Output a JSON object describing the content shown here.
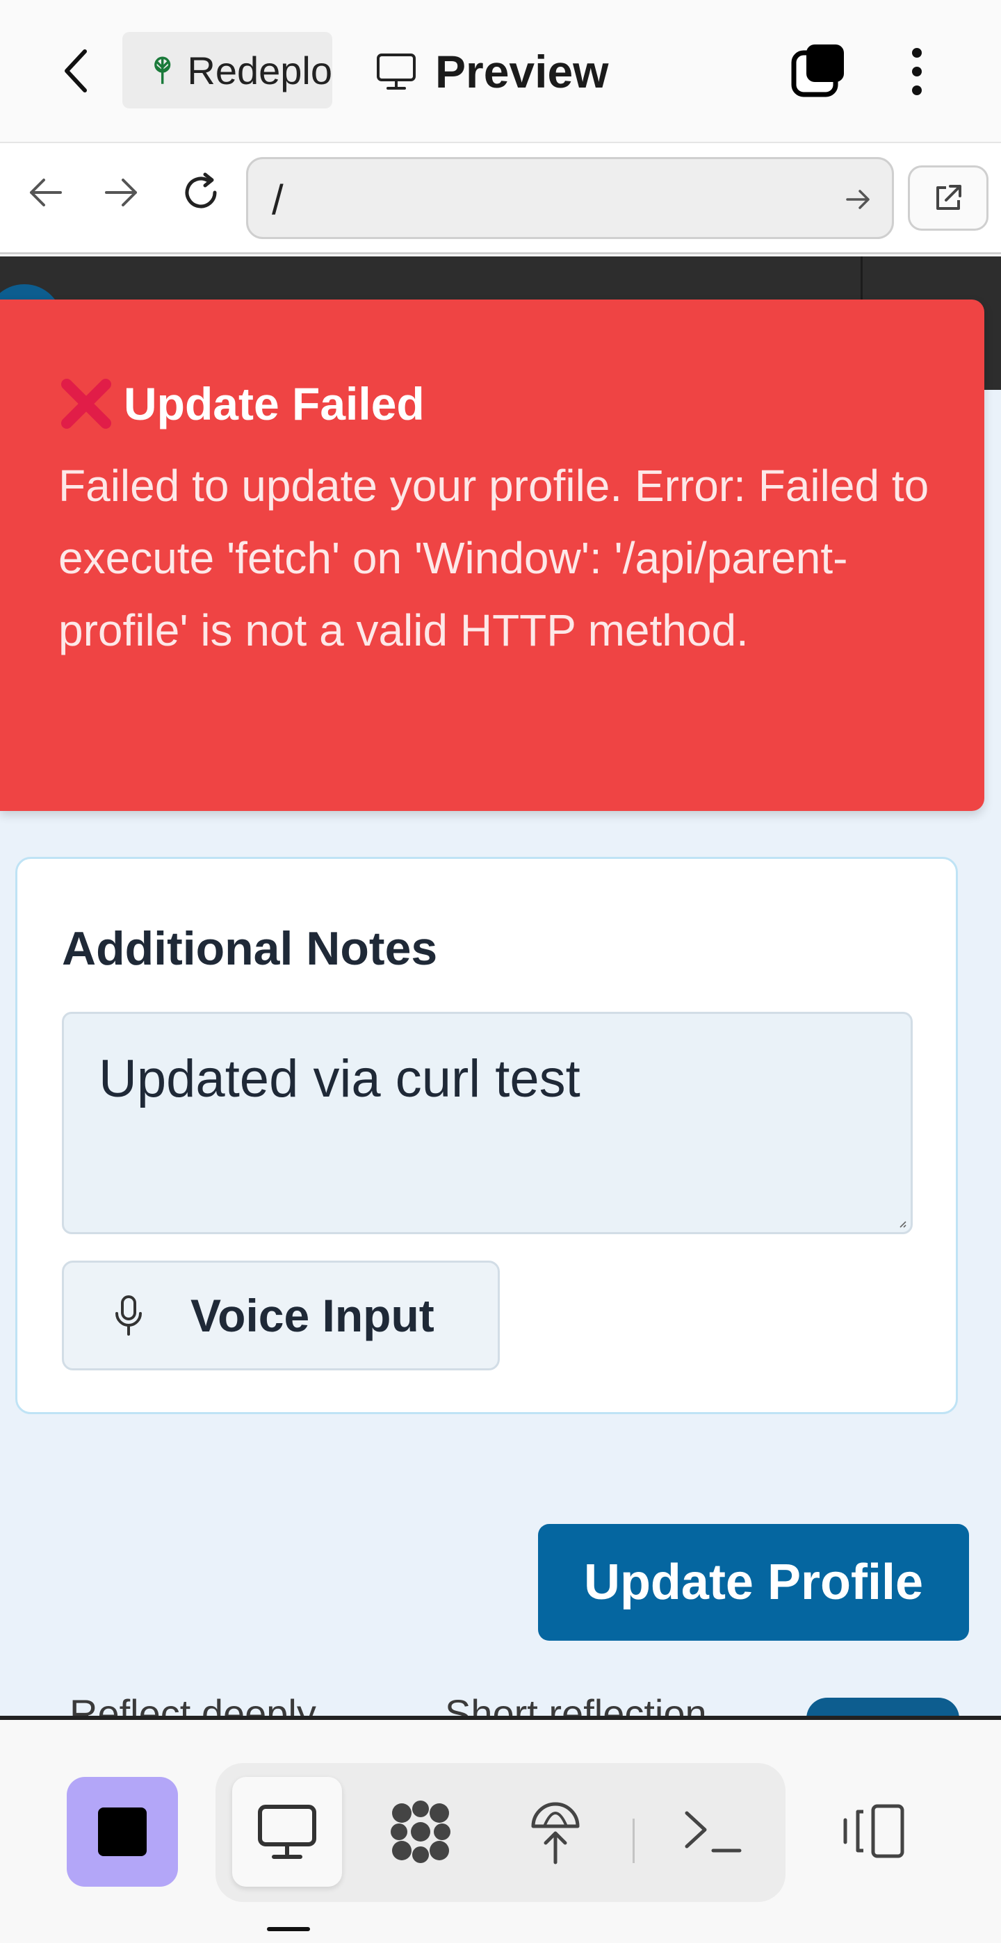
{
  "appbar": {
    "tab_label": "Redeplo",
    "preview_label": "Preview",
    "icons": [
      "chevron-left-icon",
      "spark-tree-icon",
      "monitor-icon",
      "stacked-squares-icon",
      "more-vertical-icon"
    ]
  },
  "urlbar": {
    "url": "/",
    "icons": [
      "arrow-left-icon",
      "arrow-right-icon",
      "reload-icon",
      "arrow-go-icon",
      "external-link-icon"
    ]
  },
  "toast": {
    "title": "Update Failed",
    "message": "Failed to update your profile. Error: Failed to execute 'fetch' on 'Window': '/api/parent-profile' is not a valid HTTP method.",
    "color": "#ef4444"
  },
  "form": {
    "notes_label": "Additional Notes",
    "notes_value": "Updated via curl test",
    "voice_label": "Voice Input",
    "submit_label": "Update Profile",
    "accent": "#0566a0"
  },
  "peek": {
    "left_text": "Reflect deeply",
    "right_text": "Short reflection"
  },
  "bottombar": {
    "icons": [
      "stop-icon",
      "monitor-icon",
      "agents-icon",
      "deploy-icon",
      "terminal-icon",
      "layout-icon"
    ],
    "stop_color": "#b3a6f8"
  }
}
